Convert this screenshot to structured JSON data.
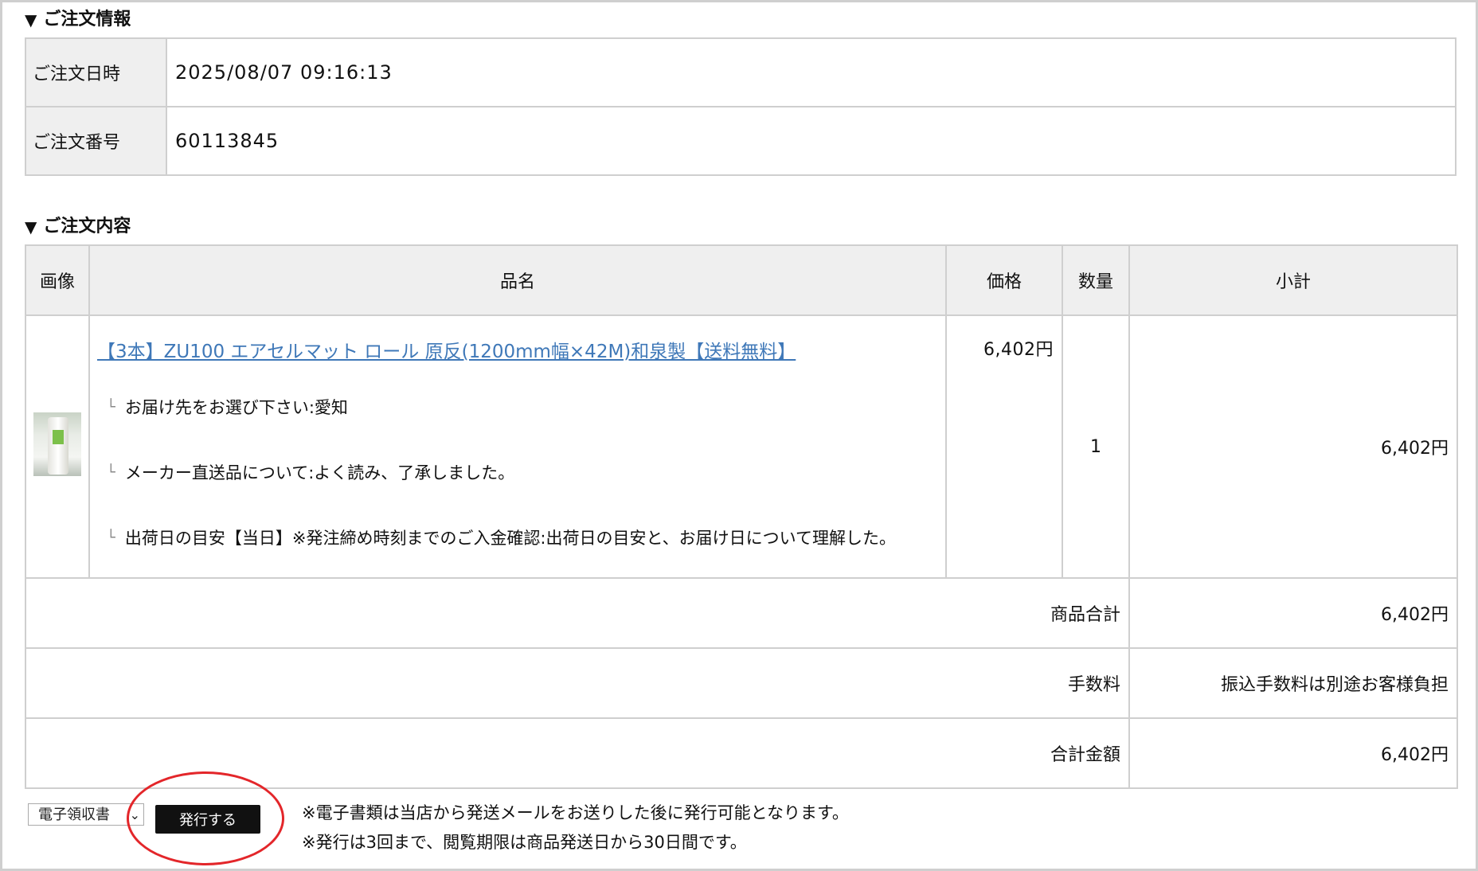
{
  "order_info": {
    "title": "ご注文情報",
    "rows": [
      {
        "label": "ご注文日時",
        "value": "2025/08/07 09:16:13"
      },
      {
        "label": "ご注文番号",
        "value": "60113845"
      }
    ]
  },
  "order_contents": {
    "title": "ご注文内容",
    "headers": {
      "image": "画像",
      "name": "品名",
      "price": "価格",
      "qty": "数量",
      "subtotal": "小計"
    },
    "item": {
      "name": "【3本】ZU100 エアセルマット ロール 原反(1200mm幅×42M)和泉製【送料無料】",
      "options": [
        "お届け先をお選び下さい:愛知",
        "メーカー直送品について:よく読み、了承しました。",
        "出荷日の目安【当日】※発注締め時刻までのご入金確認:出荷日の目安と、お届け日について理解した。"
      ],
      "price": "6,402円",
      "qty": "1",
      "subtotal": "6,402円"
    },
    "summary": [
      {
        "label": "商品合計",
        "value": "6,402円"
      },
      {
        "label": "手数料",
        "value": "振込手数料は別途お客様負担"
      },
      {
        "label": "合計金額",
        "value": "6,402円"
      }
    ]
  },
  "receipt": {
    "select_value": "電子領収書",
    "issue_label": "発行する",
    "notes": [
      "※電子書類は当店から発送メールをお送りした後に発行可能となります。",
      "※発行は3回まで、閲覧期限は商品発送日から30日間です。"
    ]
  },
  "colors": {
    "link": "#3f78b8",
    "highlight_circle": "#e3262a",
    "header_bg": "#efefef"
  }
}
